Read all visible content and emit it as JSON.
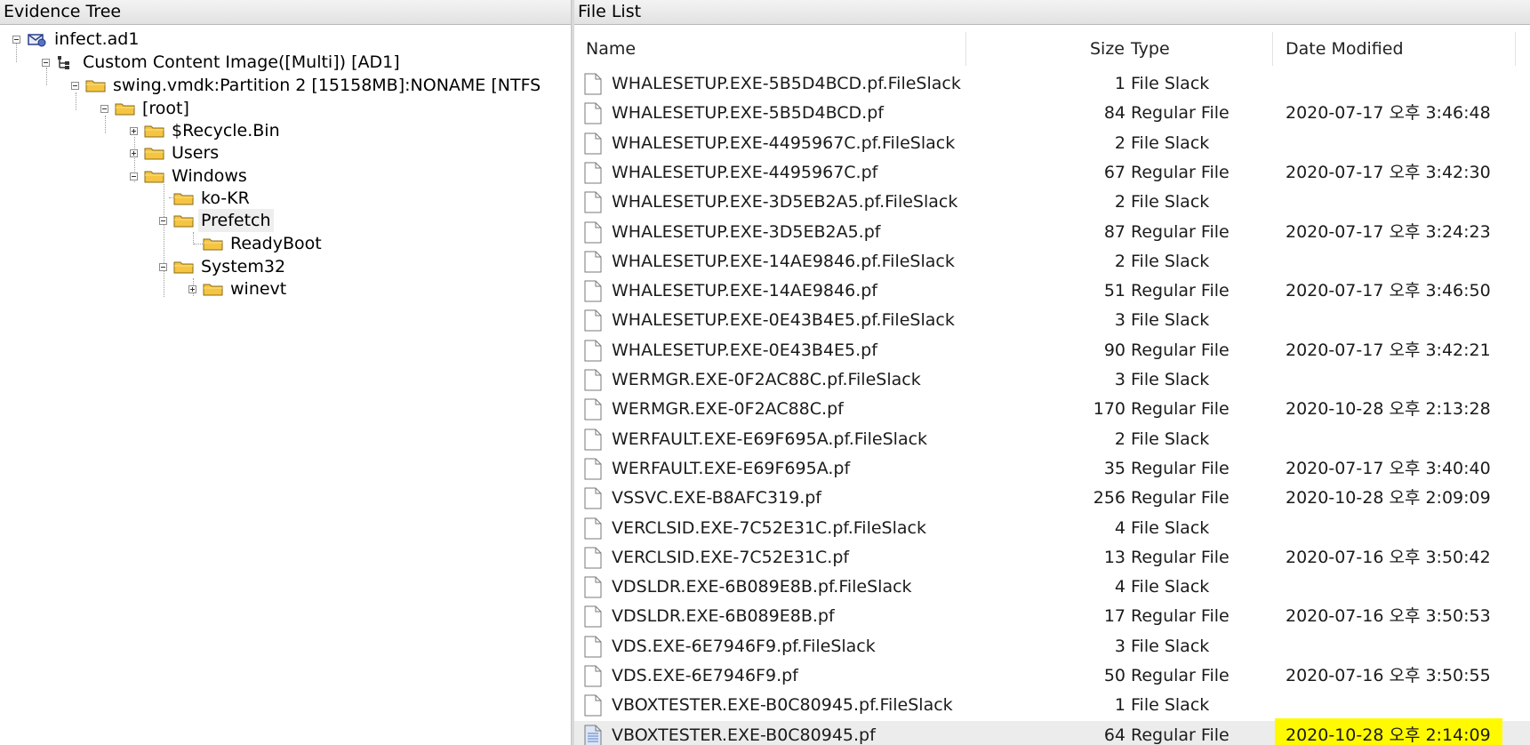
{
  "evidence_tree": {
    "title": "Evidence Tree",
    "nodes": [
      {
        "label": "infect.ad1",
        "icon": "evidence-icon",
        "expanded": true
      },
      {
        "label": "Custom Content Image([Multi]) [AD1]",
        "icon": "image-tree-icon",
        "expanded": true
      },
      {
        "label": "swing.vmdk:Partition 2 [15158MB]:NONAME [NTFS",
        "icon": "folder-icon",
        "expanded": true
      },
      {
        "label": "[root]",
        "icon": "folder-icon",
        "expanded": true
      },
      {
        "label": "$Recycle.Bin",
        "icon": "folder-icon",
        "expanded": false
      },
      {
        "label": "Users",
        "icon": "folder-icon",
        "expanded": false
      },
      {
        "label": "Windows",
        "icon": "folder-icon",
        "expanded": true
      },
      {
        "label": "ko-KR",
        "icon": "folder-icon"
      },
      {
        "label": "Prefetch",
        "icon": "folder-icon",
        "expanded": true,
        "selected": true
      },
      {
        "label": "ReadyBoot",
        "icon": "folder-icon"
      },
      {
        "label": "System32",
        "icon": "folder-icon",
        "expanded": true
      },
      {
        "label": "winevt",
        "icon": "folder-icon",
        "expanded": false
      }
    ]
  },
  "file_list": {
    "title": "File List",
    "columns": {
      "name": "Name",
      "size": "Size",
      "type": "Type",
      "date": "Date Modified"
    },
    "rows": [
      {
        "name": "WHALESETUP.EXE-5B5D4BCD.pf.FileSlack",
        "size": "1",
        "type": "File Slack",
        "date": ""
      },
      {
        "name": "WHALESETUP.EXE-5B5D4BCD.pf",
        "size": "84",
        "type": "Regular File",
        "date": "2020-07-17 오후 3:46:48"
      },
      {
        "name": "WHALESETUP.EXE-4495967C.pf.FileSlack",
        "size": "2",
        "type": "File Slack",
        "date": ""
      },
      {
        "name": "WHALESETUP.EXE-4495967C.pf",
        "size": "67",
        "type": "Regular File",
        "date": "2020-07-17 오후 3:42:30"
      },
      {
        "name": "WHALESETUP.EXE-3D5EB2A5.pf.FileSlack",
        "size": "2",
        "type": "File Slack",
        "date": ""
      },
      {
        "name": "WHALESETUP.EXE-3D5EB2A5.pf",
        "size": "87",
        "type": "Regular File",
        "date": "2020-07-17 오후 3:24:23"
      },
      {
        "name": "WHALESETUP.EXE-14AE9846.pf.FileSlack",
        "size": "2",
        "type": "File Slack",
        "date": ""
      },
      {
        "name": "WHALESETUP.EXE-14AE9846.pf",
        "size": "51",
        "type": "Regular File",
        "date": "2020-07-17 오후 3:46:50"
      },
      {
        "name": "WHALESETUP.EXE-0E43B4E5.pf.FileSlack",
        "size": "3",
        "type": "File Slack",
        "date": ""
      },
      {
        "name": "WHALESETUP.EXE-0E43B4E5.pf",
        "size": "90",
        "type": "Regular File",
        "date": "2020-07-17 오후 3:42:21"
      },
      {
        "name": "WERMGR.EXE-0F2AC88C.pf.FileSlack",
        "size": "3",
        "type": "File Slack",
        "date": ""
      },
      {
        "name": "WERMGR.EXE-0F2AC88C.pf",
        "size": "170",
        "type": "Regular File",
        "date": "2020-10-28 오후 2:13:28"
      },
      {
        "name": "WERFAULT.EXE-E69F695A.pf.FileSlack",
        "size": "2",
        "type": "File Slack",
        "date": ""
      },
      {
        "name": "WERFAULT.EXE-E69F695A.pf",
        "size": "35",
        "type": "Regular File",
        "date": "2020-07-17 오후 3:40:40"
      },
      {
        "name": "VSSVC.EXE-B8AFC319.pf",
        "size": "256",
        "type": "Regular File",
        "date": "2020-10-28 오후 2:09:09"
      },
      {
        "name": "VERCLSID.EXE-7C52E31C.pf.FileSlack",
        "size": "4",
        "type": "File Slack",
        "date": ""
      },
      {
        "name": "VERCLSID.EXE-7C52E31C.pf",
        "size": "13",
        "type": "Regular File",
        "date": "2020-07-16 오후 3:50:42"
      },
      {
        "name": "VDSLDR.EXE-6B089E8B.pf.FileSlack",
        "size": "4",
        "type": "File Slack",
        "date": ""
      },
      {
        "name": "VDSLDR.EXE-6B089E8B.pf",
        "size": "17",
        "type": "Regular File",
        "date": "2020-07-16 오후 3:50:53"
      },
      {
        "name": "VDS.EXE-6E7946F9.pf.FileSlack",
        "size": "3",
        "type": "File Slack",
        "date": ""
      },
      {
        "name": "VDS.EXE-6E7946F9.pf",
        "size": "50",
        "type": "Regular File",
        "date": "2020-07-16 오후 3:50:55"
      },
      {
        "name": "VBOXTESTER.EXE-B0C80945.pf.FileSlack",
        "size": "1",
        "type": "File Slack",
        "date": ""
      },
      {
        "name": "VBOXTESTER.EXE-B0C80945.pf",
        "size": "64",
        "type": "Regular File",
        "date": "2020-10-28 오후 2:14:09",
        "selected": true,
        "highlight": "#fffa00"
      }
    ]
  },
  "colors": {
    "highlight": "#fffa00",
    "folder": "#f5c542",
    "selected_row": "#ececec"
  }
}
